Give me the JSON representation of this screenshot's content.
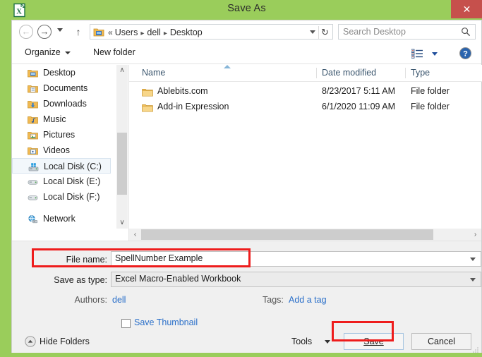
{
  "window": {
    "title": "Save As",
    "app_icon": "excel-icon",
    "close_label": "✕",
    "frame_color": "#9ACD5B",
    "close_button_color": "#C6504C"
  },
  "navbar": {
    "back_icon": "back-arrow-icon",
    "back_glyph": "←",
    "forward_icon": "forward-arrow-icon",
    "forward_glyph": "→",
    "recent_dropdown_icon": "chevron-down-icon",
    "up_icon": "up-arrow-icon",
    "up_glyph": "↑",
    "address": {
      "folder_icon": "folder-icon",
      "overflow_glyph": "«",
      "crumbs": [
        "Users",
        "dell",
        "Desktop"
      ],
      "separator_glyph": "▸",
      "dropdown_icon": "chevron-down-icon",
      "refresh_icon": "refresh-icon",
      "refresh_glyph": "↻"
    },
    "search": {
      "placeholder": "Search Desktop",
      "icon": "search-icon"
    }
  },
  "toolbar": {
    "organize_label": "Organize",
    "organize_caret_icon": "chevron-down-icon",
    "new_folder_label": "New folder",
    "view_icon": "view-layout-icon",
    "view_caret_icon": "chevron-down-icon",
    "help_icon": "help-icon",
    "help_glyph": "?"
  },
  "sidebar": {
    "items": [
      {
        "label": "Desktop",
        "icon": "desktop-folder-icon",
        "selected": false
      },
      {
        "label": "Documents",
        "icon": "documents-folder-icon",
        "selected": false
      },
      {
        "label": "Downloads",
        "icon": "downloads-folder-icon",
        "selected": false
      },
      {
        "label": "Music",
        "icon": "music-folder-icon",
        "selected": false
      },
      {
        "label": "Pictures",
        "icon": "pictures-folder-icon",
        "selected": false
      },
      {
        "label": "Videos",
        "icon": "videos-folder-icon",
        "selected": false
      },
      {
        "label": "Local Disk (C:)",
        "icon": "system-drive-icon",
        "selected": true
      },
      {
        "label": "Local Disk (E:)",
        "icon": "drive-icon",
        "selected": false
      },
      {
        "label": "Local Disk (F:)",
        "icon": "drive-icon",
        "selected": false
      },
      {
        "label": "Network",
        "icon": "network-icon",
        "selected": false
      }
    ],
    "scroll_up_glyph": "∧",
    "scroll_down_glyph": "∨"
  },
  "filelist": {
    "columns": [
      "Name",
      "Date modified",
      "Type"
    ],
    "sort_column": "Name",
    "sort_direction": "ascending",
    "rows": [
      {
        "name": "Ablebits.com",
        "date_modified": "8/23/2017 5:11 AM",
        "type": "File folder",
        "icon": "folder-icon"
      },
      {
        "name": "Add-in Expression",
        "date_modified": "6/1/2020 11:09 AM",
        "type": "File folder",
        "icon": "folder-icon"
      }
    ],
    "hscroll_left_glyph": "‹",
    "hscroll_right_glyph": "›"
  },
  "form": {
    "file_name_label": "File name:",
    "file_name_value": "SpellNumber Example",
    "save_as_type_label": "Save as type:",
    "save_as_type_value": "Excel Macro-Enabled Workbook",
    "authors_label": "Authors:",
    "authors_value": "dell",
    "tags_label": "Tags:",
    "tags_value": "Add a tag",
    "save_thumbnail_label": "Save Thumbnail",
    "save_thumbnail_checked": false,
    "dropdown_icon": "chevron-down-icon"
  },
  "footer": {
    "hide_folders_label": "Hide Folders",
    "hide_folders_icon": "collapse-up-icon",
    "tools_label": "Tools",
    "tools_caret_icon": "chevron-down-icon",
    "save_label": "Save",
    "cancel_label": "Cancel",
    "resize_grip_icon": "resize-grip-icon"
  },
  "annotations": {
    "color": "#EE1C1C",
    "highlighted": [
      "save-as-type-combo",
      "save-button"
    ]
  }
}
